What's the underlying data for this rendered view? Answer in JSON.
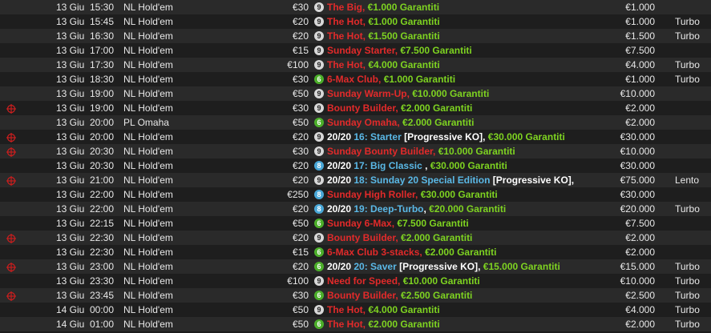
{
  "colors": {
    "red": "#e22a2a",
    "green": "#7ed321",
    "blue": "#5ab8e6",
    "white": "#ffffff"
  },
  "rows": [
    {
      "bounty": false,
      "date": "13 Giu",
      "time": "15:30",
      "game": "NL Hold'em",
      "buyin": "€30",
      "seats": "9",
      "name": [
        {
          "t": "The Big",
          "c": "red"
        },
        {
          "t": ", ",
          "c": "red"
        },
        {
          "t": "€1.000 Garantiti",
          "c": "green"
        }
      ],
      "prize": "€1.000",
      "speed": ""
    },
    {
      "bounty": false,
      "date": "13 Giu",
      "time": "15:45",
      "game": "NL Hold'em",
      "buyin": "€20",
      "seats": "9",
      "name": [
        {
          "t": "The Hot",
          "c": "red"
        },
        {
          "t": ", ",
          "c": "red"
        },
        {
          "t": "€1.000 Garantiti",
          "c": "green"
        }
      ],
      "prize": "€1.000",
      "speed": "Turbo"
    },
    {
      "bounty": false,
      "date": "13 Giu",
      "time": "16:30",
      "game": "NL Hold'em",
      "buyin": "€20",
      "seats": "9",
      "name": [
        {
          "t": "The Hot",
          "c": "red"
        },
        {
          "t": ", ",
          "c": "red"
        },
        {
          "t": "€1.500 Garantiti",
          "c": "green"
        }
      ],
      "prize": "€1.500",
      "speed": "Turbo"
    },
    {
      "bounty": false,
      "date": "13 Giu",
      "time": "17:00",
      "game": "NL Hold'em",
      "buyin": "€15",
      "seats": "9",
      "name": [
        {
          "t": "Sunday Starter",
          "c": "red"
        },
        {
          "t": ", ",
          "c": "red"
        },
        {
          "t": "€7.500 Garantiti",
          "c": "green"
        }
      ],
      "prize": "€7.500",
      "speed": ""
    },
    {
      "bounty": false,
      "date": "13 Giu",
      "time": "17:30",
      "game": "NL Hold'em",
      "buyin": "€100",
      "seats": "9",
      "name": [
        {
          "t": "The Hot",
          "c": "red"
        },
        {
          "t": ", ",
          "c": "red"
        },
        {
          "t": "€4.000 Garantiti",
          "c": "green"
        }
      ],
      "prize": "€4.000",
      "speed": "Turbo"
    },
    {
      "bounty": false,
      "date": "13 Giu",
      "time": "18:30",
      "game": "NL Hold'em",
      "buyin": "€30",
      "seats": "6",
      "name": [
        {
          "t": "6-Max Club",
          "c": "red"
        },
        {
          "t": ", ",
          "c": "red"
        },
        {
          "t": "€1.000 Garantiti",
          "c": "green"
        }
      ],
      "prize": "€1.000",
      "speed": "Turbo"
    },
    {
      "bounty": false,
      "date": "13 Giu",
      "time": "19:00",
      "game": "NL Hold'em",
      "buyin": "€50",
      "seats": "9",
      "name": [
        {
          "t": "Sunday Warm-Up",
          "c": "red"
        },
        {
          "t": ", ",
          "c": "red"
        },
        {
          "t": "€10.000 Garantiti",
          "c": "green"
        }
      ],
      "prize": "€10.000",
      "speed": ""
    },
    {
      "bounty": true,
      "date": "13 Giu",
      "time": "19:00",
      "game": "NL Hold'em",
      "buyin": "€30",
      "seats": "9",
      "name": [
        {
          "t": "Bounty Builder",
          "c": "red"
        },
        {
          "t": ", ",
          "c": "red"
        },
        {
          "t": "€2.000 Garantiti",
          "c": "green"
        }
      ],
      "prize": "€2.000",
      "speed": ""
    },
    {
      "bounty": false,
      "date": "13 Giu",
      "time": "20:00",
      "game": "PL Omaha",
      "buyin": "€50",
      "seats": "6",
      "name": [
        {
          "t": "Sunday Omaha",
          "c": "red"
        },
        {
          "t": ", ",
          "c": "red"
        },
        {
          "t": "€2.000 Garantiti",
          "c": "green"
        }
      ],
      "prize": "€2.000",
      "speed": ""
    },
    {
      "bounty": true,
      "date": "13 Giu",
      "time": "20:00",
      "game": "NL Hold'em",
      "buyin": "€20",
      "seats": "9",
      "name": [
        {
          "t": "20/20 ",
          "c": "white"
        },
        {
          "t": "16: Starter",
          "c": "blue"
        },
        {
          "t": " [Progressive KO], ",
          "c": "white"
        },
        {
          "t": "€30.000 Garantiti",
          "c": "green"
        }
      ],
      "prize": "€30.000",
      "speed": ""
    },
    {
      "bounty": true,
      "date": "13 Giu",
      "time": "20:30",
      "game": "NL Hold'em",
      "buyin": "€30",
      "seats": "9",
      "name": [
        {
          "t": "Sunday Bounty Builder",
          "c": "red"
        },
        {
          "t": ", ",
          "c": "red"
        },
        {
          "t": "€10.000 Garantiti",
          "c": "green"
        }
      ],
      "prize": "€10.000",
      "speed": ""
    },
    {
      "bounty": false,
      "date": "13 Giu",
      "time": "20:30",
      "game": "NL Hold'em",
      "buyin": "€20",
      "seats": "8",
      "name": [
        {
          "t": "20/20 ",
          "c": "white"
        },
        {
          "t": "17: Big Classic ",
          "c": "blue"
        },
        {
          "t": ", ",
          "c": "white"
        },
        {
          "t": "€30.000 Garantiti",
          "c": "green"
        }
      ],
      "prize": "€30.000",
      "speed": ""
    },
    {
      "bounty": true,
      "date": "13 Giu",
      "time": "21:00",
      "game": "NL Hold'em",
      "buyin": "€20",
      "seats": "9",
      "name": [
        {
          "t": "20/20 ",
          "c": "white"
        },
        {
          "t": "18: Sunday 20 Special Edition",
          "c": "blue"
        },
        {
          "t": " [Progressive KO],",
          "c": "white"
        }
      ],
      "prize": "€75.000",
      "speed": "Lento"
    },
    {
      "bounty": false,
      "date": "13 Giu",
      "time": "22:00",
      "game": "NL Hold'em",
      "buyin": "€250",
      "seats": "8",
      "name": [
        {
          "t": "Sunday High Roller",
          "c": "red"
        },
        {
          "t": ", ",
          "c": "red"
        },
        {
          "t": "€30.000 Garantiti",
          "c": "green"
        }
      ],
      "prize": "€30.000",
      "speed": ""
    },
    {
      "bounty": false,
      "date": "13 Giu",
      "time": "22:00",
      "game": "NL Hold'em",
      "buyin": "€20",
      "seats": "8",
      "name": [
        {
          "t": "20/20 ",
          "c": "white"
        },
        {
          "t": "19: Deep-Turbo",
          "c": "blue"
        },
        {
          "t": ", ",
          "c": "white"
        },
        {
          "t": "€20.000 Garantiti",
          "c": "green"
        }
      ],
      "prize": "€20.000",
      "speed": "Turbo"
    },
    {
      "bounty": false,
      "date": "13 Giu",
      "time": "22:15",
      "game": "NL Hold'em",
      "buyin": "€50",
      "seats": "6",
      "name": [
        {
          "t": "Sunday 6-Max",
          "c": "red"
        },
        {
          "t": ", ",
          "c": "red"
        },
        {
          "t": "€7.500 Garantiti",
          "c": "green"
        }
      ],
      "prize": "€7.500",
      "speed": ""
    },
    {
      "bounty": true,
      "date": "13 Giu",
      "time": "22:30",
      "game": "NL Hold'em",
      "buyin": "€20",
      "seats": "9",
      "name": [
        {
          "t": "Bounty Builder",
          "c": "red"
        },
        {
          "t": ", ",
          "c": "red"
        },
        {
          "t": "€2.000 Garantiti",
          "c": "green"
        }
      ],
      "prize": "€2.000",
      "speed": ""
    },
    {
      "bounty": false,
      "date": "13 Giu",
      "time": "22:30",
      "game": "NL Hold'em",
      "buyin": "€15",
      "seats": "6",
      "name": [
        {
          "t": "6-Max Club 3-stacks",
          "c": "red"
        },
        {
          "t": ", ",
          "c": "red"
        },
        {
          "t": "€2.000 Garantiti",
          "c": "green"
        }
      ],
      "prize": "€2.000",
      "speed": ""
    },
    {
      "bounty": true,
      "date": "13 Giu",
      "time": "23:00",
      "game": "NL Hold'em",
      "buyin": "€20",
      "seats": "6",
      "name": [
        {
          "t": "20/20 ",
          "c": "white"
        },
        {
          "t": "20: Saver",
          "c": "blue"
        },
        {
          "t": " [Progressive KO], ",
          "c": "white"
        },
        {
          "t": "€15.000 Garantiti",
          "c": "green"
        }
      ],
      "prize": "€15.000",
      "speed": "Turbo"
    },
    {
      "bounty": false,
      "date": "13 Giu",
      "time": "23:30",
      "game": "NL Hold'em",
      "buyin": "€100",
      "seats": "9",
      "name": [
        {
          "t": "Need for Speed",
          "c": "red"
        },
        {
          "t": ", ",
          "c": "red"
        },
        {
          "t": "€10.000 Garantiti",
          "c": "green"
        }
      ],
      "prize": "€10.000",
      "speed": "Turbo"
    },
    {
      "bounty": true,
      "date": "13 Giu",
      "time": "23:45",
      "game": "NL Hold'em",
      "buyin": "€30",
      "seats": "6",
      "name": [
        {
          "t": "Bounty Builder",
          "c": "red"
        },
        {
          "t": ", ",
          "c": "red"
        },
        {
          "t": "€2.500 Garantiti",
          "c": "green"
        }
      ],
      "prize": "€2.500",
      "speed": "Turbo"
    },
    {
      "bounty": false,
      "date": "14 Giu",
      "time": "00:00",
      "game": "NL Hold'em",
      "buyin": "€50",
      "seats": "9",
      "name": [
        {
          "t": "The Hot",
          "c": "red"
        },
        {
          "t": ", ",
          "c": "red"
        },
        {
          "t": "€4.000 Garantiti",
          "c": "green"
        }
      ],
      "prize": "€4.000",
      "speed": "Turbo"
    },
    {
      "bounty": false,
      "date": "14 Giu",
      "time": "01:00",
      "game": "NL Hold'em",
      "buyin": "€50",
      "seats": "6",
      "name": [
        {
          "t": "The Hot",
          "c": "red"
        },
        {
          "t": ", ",
          "c": "red"
        },
        {
          "t": "€2.000 Garantiti",
          "c": "green"
        }
      ],
      "prize": "€2.000",
      "speed": "Turbo"
    }
  ]
}
